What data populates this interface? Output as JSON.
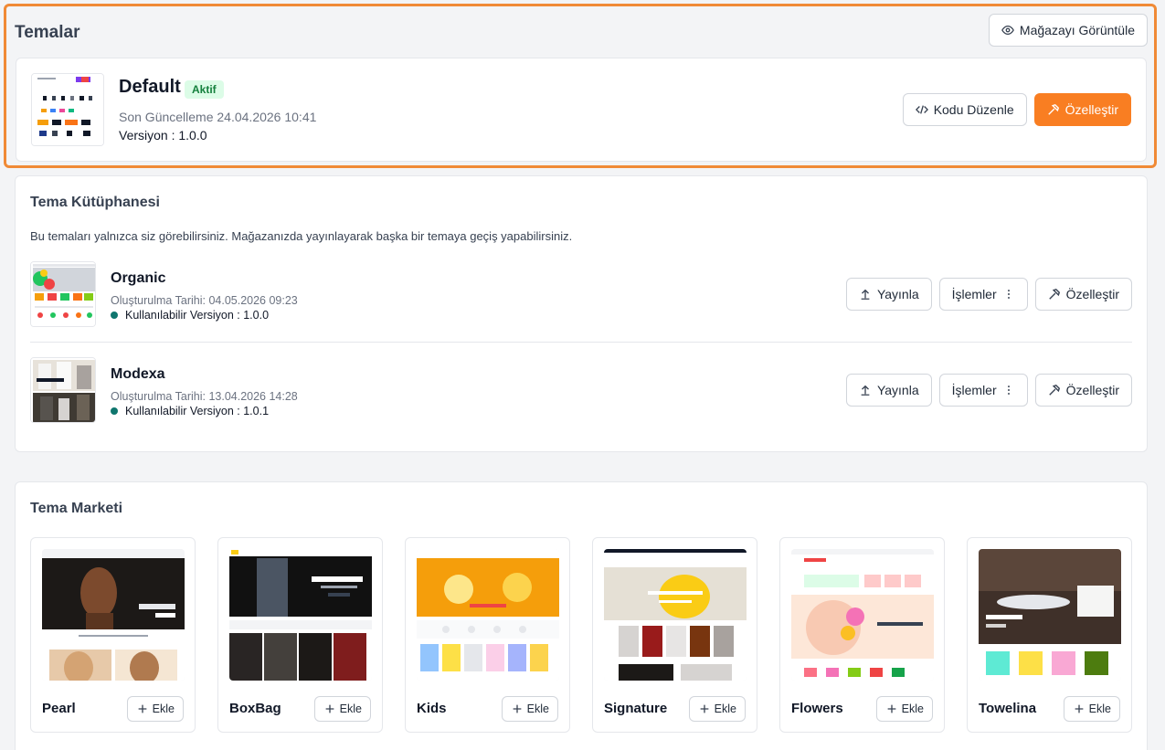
{
  "header": {
    "title": "Temalar",
    "view_store": "Mağazayı Görüntüle"
  },
  "active_theme": {
    "name": "Default",
    "badge": "Aktif",
    "updated": "Son Güncelleme 24.04.2026 10:41",
    "version": "Versiyon : 1.0.0",
    "edit_code": "Kodu Düzenle",
    "customize": "Özelleştir"
  },
  "library": {
    "title": "Tema Kütüphanesi",
    "description": "Bu temaları yalnızca siz görebilirsiniz. Mağazanızda yayınlayarak başka bir temaya geçiş yapabilirsiniz.",
    "items": [
      {
        "name": "Organic",
        "created": "Oluşturulma Tarihi: 04.05.2026 09:23",
        "version": "Kullanılabilir Versiyon : 1.0.0",
        "publish": "Yayınla",
        "actions": "İşlemler",
        "customize": "Özelleştir"
      },
      {
        "name": "Modexa",
        "created": "Oluşturulma Tarihi: 13.04.2026 14:28",
        "version": "Kullanılabilir Versiyon : 1.0.1",
        "publish": "Yayınla",
        "actions": "İşlemler",
        "customize": "Özelleştir"
      }
    ]
  },
  "market": {
    "title": "Tema Marketi",
    "items": [
      {
        "name": "Pearl",
        "add": "Ekle"
      },
      {
        "name": "BoxBag",
        "add": "Ekle"
      },
      {
        "name": "Kids",
        "add": "Ekle"
      },
      {
        "name": "Signature",
        "add": "Ekle"
      },
      {
        "name": "Flowers",
        "add": "Ekle"
      },
      {
        "name": "Towelina",
        "add": "Ekle"
      }
    ]
  },
  "colors": {
    "accent": "#f97e22",
    "highlight_border": "#f08a36",
    "active_badge_bg": "#dcfce7",
    "active_badge_text": "#15803d",
    "status_dot": "#0f766e"
  },
  "icons": {
    "view_store": "eye-icon",
    "edit_code": "code-icon",
    "customize": "hammer-icon",
    "publish": "upload-icon",
    "actions": "more-vertical-icon",
    "add": "plus-icon"
  }
}
